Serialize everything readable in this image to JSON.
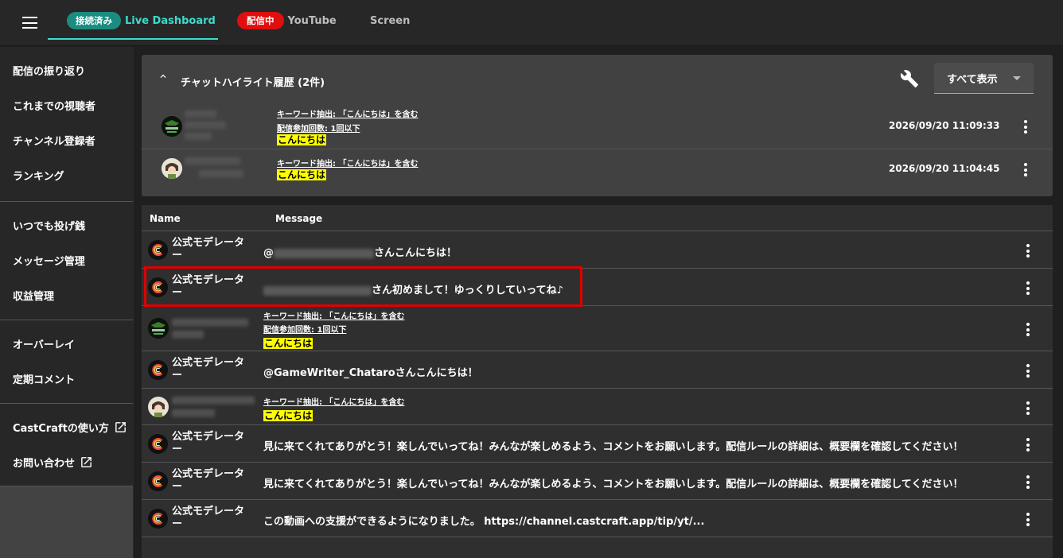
{
  "tabs": [
    {
      "badge": "接続済み",
      "label": "Live Dashboard",
      "active": true
    },
    {
      "badge": "配信中",
      "label": "YouTube",
      "active": false
    },
    {
      "badge": "",
      "label": "Screen",
      "active": false
    }
  ],
  "sidebar": {
    "group1": [
      "配信の振り返り",
      "これまでの視聴者",
      "チャンネル登録者",
      "ランキング"
    ],
    "group2": [
      "いつでも投げ銭",
      "メッセージ管理",
      "収益管理"
    ],
    "group3": [
      "オーバーレイ",
      "定期コメント"
    ],
    "group4": [
      "CastCraftの使い方",
      "お問い合わせ"
    ]
  },
  "highlights": {
    "title": "チャットハイライト履歴 (2件)",
    "filter_label": "すべて表示",
    "rows": [
      {
        "cond1": "キーワード抽出: 「こんにちは」を含む",
        "cond2": "配信参加回数: 1回以下",
        "word": "こんにちは",
        "time": "2026/09/20 11:09:33"
      },
      {
        "cond1": "キーワード抽出: 「こんにちは」を含む",
        "word": "こんにちは",
        "time": "2026/09/20 11:04:45"
      }
    ]
  },
  "messages": {
    "col_name": "Name",
    "col_message": "Message",
    "rows": [
      {
        "name": "公式モデレーター",
        "text_prefix": "@",
        "text": "さんこんにちは！"
      },
      {
        "name": "公式モデレーター",
        "text": "さん初めまして！ゆっくりしていってね♪"
      },
      {
        "cond1": "キーワード抽出: 「こんにちは」を含む",
        "cond2": "配信参加回数: 1回以下",
        "word": "こんにちは"
      },
      {
        "name": "公式モデレーター",
        "text": "@GameWriter_Chataroさんこんにちは！"
      },
      {
        "cond1": "キーワード抽出: 「こんにちは」を含む",
        "word": "こんにちは"
      },
      {
        "name": "公式モデレーター",
        "text": "見に来てくれてありがとう！楽しんでいってね！みんなが楽しめるよう、コメントをお願いします。配信ルールの詳細は、概要欄を確認してください！"
      },
      {
        "name": "公式モデレーター",
        "text": "見に来てくれてありがとう！楽しんでいってね！みんなが楽しめるよう、コメントをお願いします。配信ルールの詳細は、概要欄を確認してください！"
      },
      {
        "name": "公式モデレーター",
        "text": "この動画への支援ができるようになりました。 https://channel.castcraft.app/tip/yt/..."
      }
    ]
  },
  "colors": {
    "accent": "#3bdccb",
    "live_badge": "#e00e0e",
    "highlight": "#ffff00",
    "focus_border": "#e00000"
  }
}
